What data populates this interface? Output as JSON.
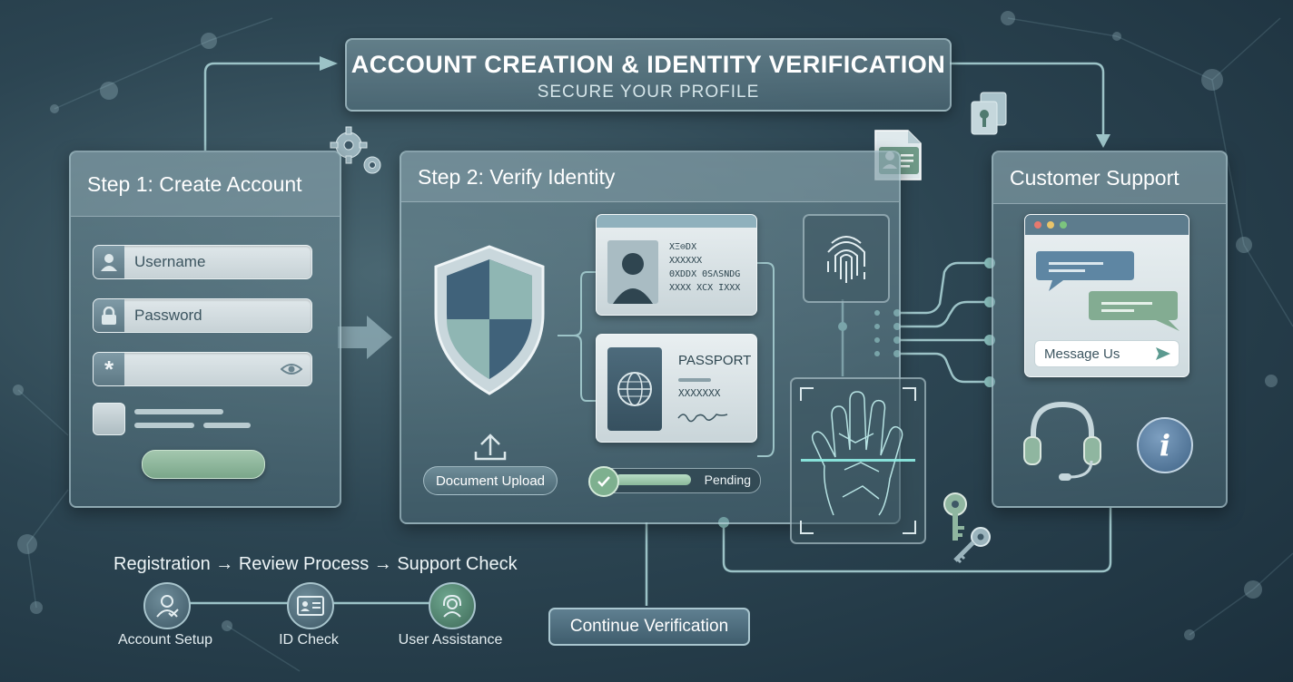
{
  "banner": {
    "title": "ACCOUNT CREATION & IDENTITY VERIFICATION",
    "subtitle": "SECURE YOUR PROFILE"
  },
  "step1": {
    "title": "Step 1: Create Account",
    "username_placeholder": "Username",
    "password_placeholder": "Password"
  },
  "step2": {
    "title": "Step 2: Verify Identity",
    "id_card_lines": [
      "XΞ⊖DX",
      "XXXXXX",
      "ΘXDDX ΘSΛSNDG",
      "XXXX XCX IXXX"
    ],
    "passport_label": "PASSPORT",
    "passport_number": "XXXXXXX",
    "upload_label": "Document Upload",
    "status_label": "Pending",
    "progress": 0.6
  },
  "support": {
    "title": "Customer Support",
    "message_placeholder": "Message Us"
  },
  "flow": {
    "heading": "Registration → Review Process → Support Check",
    "steps": [
      {
        "label": "Account Setup",
        "icon": "user-check-icon"
      },
      {
        "label": "ID Check",
        "icon": "id-card-icon"
      },
      {
        "label": "User Assistance",
        "icon": "headset-icon"
      }
    ]
  },
  "continue_button": "Continue Verification",
  "colors": {
    "accent_teal": "#8fd9d0",
    "accent_green": "#86b39a",
    "panel_border": "#bed7de",
    "background": "#2c4552"
  }
}
